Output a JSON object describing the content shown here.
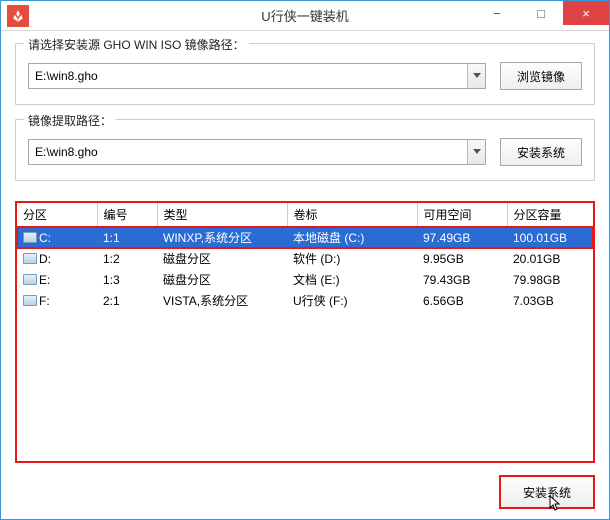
{
  "window": {
    "title": "U行侠一键装机"
  },
  "controls": {
    "min": "−",
    "max": "□",
    "close": "×"
  },
  "group1": {
    "label": "请选择安装源 GHO WIN ISO 镜像路径：",
    "path": "E:\\win8.gho",
    "browse": "浏览镜像"
  },
  "group2": {
    "label": "镜像提取路径：",
    "path": "E:\\win8.gho",
    "install": "安装系统"
  },
  "table": {
    "headers": [
      "分区",
      "编号",
      "类型",
      "卷标",
      "可用空间",
      "分区容量"
    ],
    "rows": [
      {
        "part": "C:",
        "num": "1:1",
        "type": "WINXP,系统分区",
        "label": "本地磁盘 (C:)",
        "free": "97.49GB",
        "cap": "100.01GB",
        "selected": true
      },
      {
        "part": "D:",
        "num": "1:2",
        "type": "磁盘分区",
        "label": "软件 (D:)",
        "free": "9.95GB",
        "cap": "20.01GB"
      },
      {
        "part": "E:",
        "num": "1:3",
        "type": "磁盘分区",
        "label": "文档 (E:)",
        "free": "79.43GB",
        "cap": "79.98GB"
      },
      {
        "part": "F:",
        "num": "2:1",
        "type": "VISTA,系统分区",
        "label": "U行侠 (F:)",
        "free": "6.56GB",
        "cap": "7.03GB"
      }
    ]
  },
  "footer": {
    "install": "安装系统"
  }
}
